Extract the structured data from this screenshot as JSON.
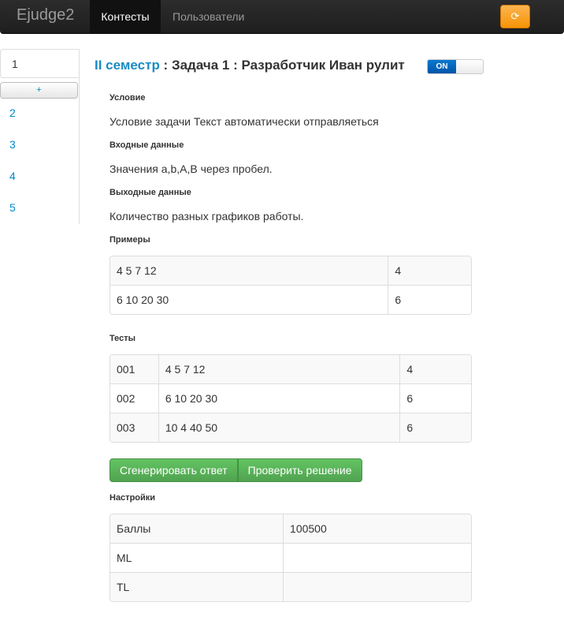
{
  "navbar": {
    "brand": "Ejudge2",
    "links": [
      "Контесты",
      "Пользователи"
    ],
    "refresh_icon": "⟳",
    "colors": {
      "accent": "#f89406"
    }
  },
  "sidebar": {
    "active_item": "1",
    "add_label": "+",
    "items": [
      "2",
      "3",
      "4",
      "5"
    ]
  },
  "problem": {
    "semester": "II семестр",
    "sep1": " : ",
    "task": "Задача 1",
    "sep2": " : ",
    "title": "Разработчик Иван рулит",
    "toggle_label": "ON"
  },
  "sections": {
    "condition_label": "Условие",
    "condition_text": "Условие задачи Текст автоматически отправляеться",
    "input_label": "Входные данные",
    "input_text": "Значения a,b,A,B через пробел.",
    "output_label": "Выходные данные",
    "output_text": "Количество разных графиков работы.",
    "examples_label": "Примеры",
    "tests_label": "Тесты",
    "settings_label": "Настройки"
  },
  "examples": [
    [
      "4 5 7 12",
      "4"
    ],
    [
      "6 10 20 30",
      "6"
    ]
  ],
  "tests": [
    [
      "001",
      "4 5 7 12",
      "4"
    ],
    [
      "002",
      "6 10 20 30",
      "6"
    ],
    [
      "003",
      "10 4 40 50",
      "6"
    ]
  ],
  "buttons": {
    "generate": "Сгенерировать ответ",
    "check": "Проверить решение"
  },
  "settings": [
    [
      "Баллы",
      "100500"
    ],
    [
      "ML",
      ""
    ],
    [
      "TL",
      ""
    ]
  ]
}
